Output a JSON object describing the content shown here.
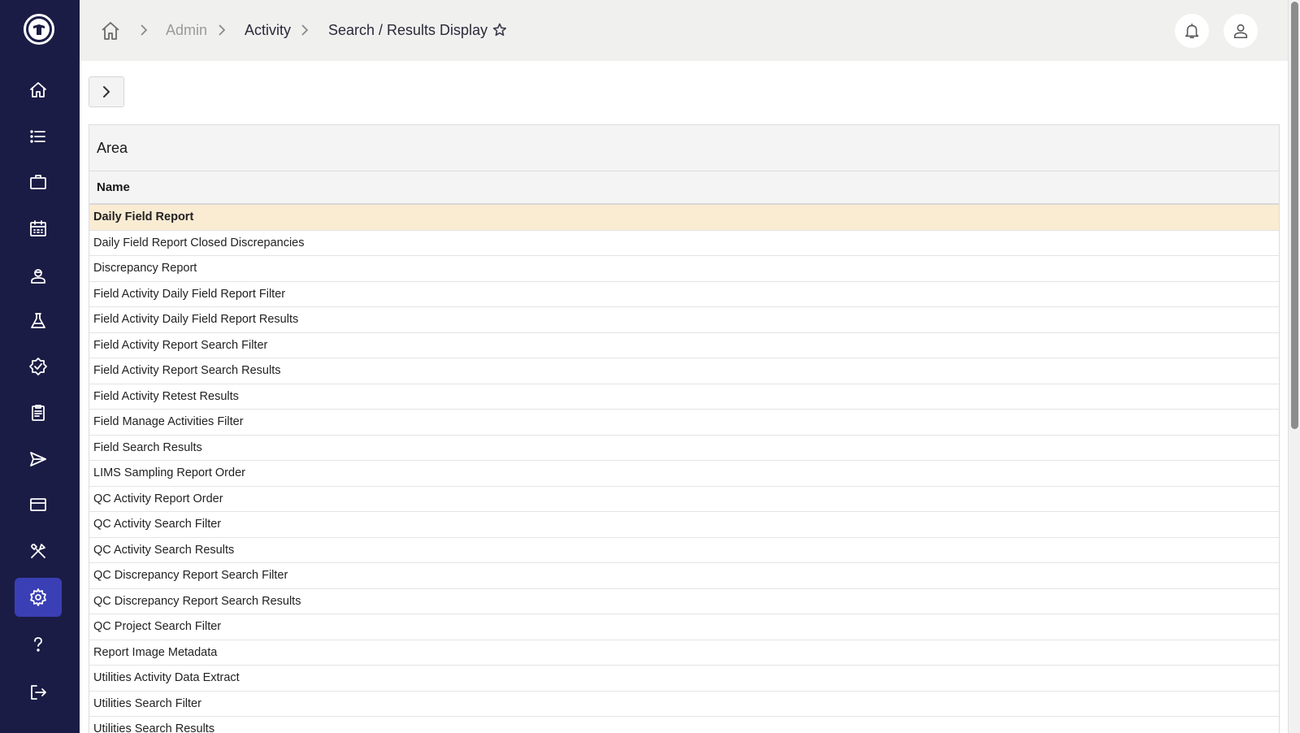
{
  "sidebar": {
    "logo_icon": "company-logo-icon",
    "items": [
      {
        "name": "home",
        "icon": "home-icon",
        "active": false
      },
      {
        "name": "list",
        "icon": "list-icon",
        "active": false
      },
      {
        "name": "projects",
        "icon": "briefcase-icon",
        "active": false
      },
      {
        "name": "calendar",
        "icon": "calendar-icon",
        "active": false
      },
      {
        "name": "personnel",
        "icon": "worker-icon",
        "active": false
      },
      {
        "name": "lab",
        "icon": "flask-icon",
        "active": false
      },
      {
        "name": "qc",
        "icon": "verified-badge-icon",
        "active": false
      },
      {
        "name": "reports",
        "icon": "clipboard-icon",
        "active": false
      },
      {
        "name": "send",
        "icon": "send-icon",
        "active": false
      },
      {
        "name": "billing",
        "icon": "credit-card-icon",
        "active": false
      },
      {
        "name": "tools",
        "icon": "tools-icon",
        "active": false
      },
      {
        "name": "admin",
        "icon": "gear-icon",
        "active": true
      },
      {
        "name": "help",
        "icon": "question-icon",
        "active": false
      },
      {
        "name": "logout",
        "icon": "logout-icon",
        "active": false
      }
    ]
  },
  "breadcrumb": {
    "items": [
      "Admin",
      "Activity",
      "Search / Results Display"
    ]
  },
  "table": {
    "title": "Area",
    "column_header": "Name",
    "selected_index": 0,
    "rows": [
      "Daily Field Report",
      "Daily Field Report Closed Discrepancies",
      "Discrepancy Report",
      "Field Activity Daily Field Report Filter",
      "Field Activity Daily Field Report Results",
      "Field Activity Report Search Filter",
      "Field Activity Report Search Results",
      "Field Activity Retest Results",
      "Field Manage Activities Filter",
      "Field Search Results",
      "LIMS Sampling Report Order",
      "QC Activity Report Order",
      "QC Activity Search Filter",
      "QC Activity Search Results",
      "QC Discrepancy Report Search Filter",
      "QC Discrepancy Report Search Results",
      "QC Project Search Filter",
      "Report Image Metadata",
      "Utilities Activity Data Extract",
      "Utilities Search Filter",
      "Utilities Search Results"
    ]
  },
  "colors": {
    "sidebar_bg": "#1b1c45",
    "active_nav": "#3a3fb5",
    "header_bg": "#f0f0ef",
    "selected_row": "#faebd3"
  }
}
